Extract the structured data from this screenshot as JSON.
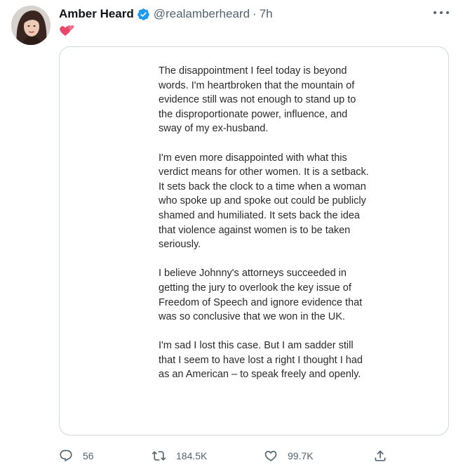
{
  "author": {
    "display_name": "Amber Heard",
    "handle": "@realamberheard",
    "separator": "·",
    "time": "7h",
    "verified": true
  },
  "tweet": {
    "emoji": "💕",
    "statement_paragraphs": [
      "The disappointment I feel today is beyond words. I'm heartbroken that the mountain of evidence still was not enough to stand up to the disproportionate power, influence, and sway of my ex-husband.",
      "I'm even more disappointed with what this verdict means for other women. It is a setback. It sets back the clock to a time when a woman who spoke up and spoke out could be publicly shamed and humiliated. It sets back the idea that violence against women is to be taken seriously.",
      "I believe Johnny's attorneys succeeded in getting the jury to overlook the key issue of Freedom of Speech and ignore evidence that was so conclusive that we won in the UK.",
      "I'm sad I lost this case. But I am sadder still that I seem to have lost a right I thought I had as an American – to speak freely and openly."
    ]
  },
  "actions": {
    "replies": "56",
    "retweets": "184.5K",
    "likes": "99.7K"
  },
  "icons": {
    "reply": "reply-icon",
    "retweet": "retweet-icon",
    "like": "heart-icon",
    "share": "share-icon",
    "more": "more-icon",
    "verified": "verified-badge-icon"
  },
  "colors": {
    "verified_blue": "#1d9bf0",
    "secondary_text": "#536471",
    "card_border": "#cfd9de",
    "emoji_pink": "#e8476a"
  }
}
